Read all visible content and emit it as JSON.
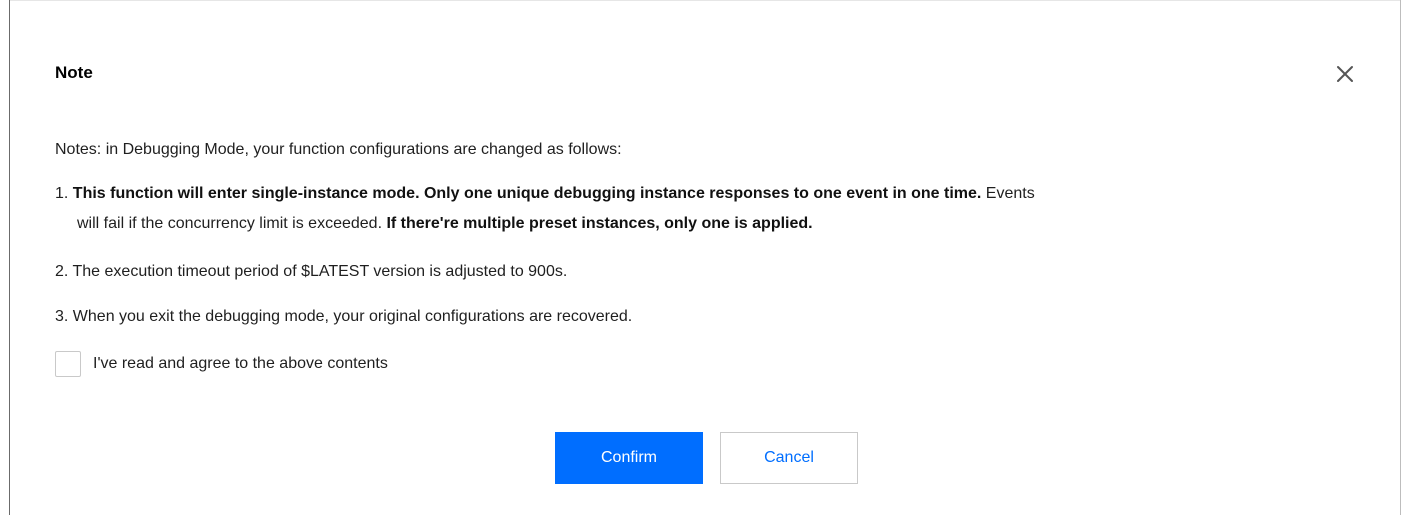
{
  "dialog": {
    "title": "Note",
    "close_icon": "close-icon",
    "intro": "Notes: in Debugging Mode, your function configurations are changed as follows:",
    "item1": {
      "number": "1. ",
      "bold_a": "This function will enter single-instance mode. Only one unique debugging instance responses to one event in one time.",
      "plain_a": " Events",
      "plain_b": "will fail if the concurrency limit is exceeded. ",
      "bold_b": "If there're multiple preset instances, only one is applied."
    },
    "item2": "2. The execution timeout period of $LATEST version is adjusted to 900s.",
    "item3": "3. When you exit the debugging mode, your original configurations are recovered.",
    "agree_label": "I've read and agree to the above contents",
    "agree_checked": false,
    "confirm_label": "Confirm",
    "cancel_label": "Cancel"
  },
  "colors": {
    "primary": "#006eff",
    "text": "#1f1f1f",
    "border": "#c9c9c9"
  }
}
